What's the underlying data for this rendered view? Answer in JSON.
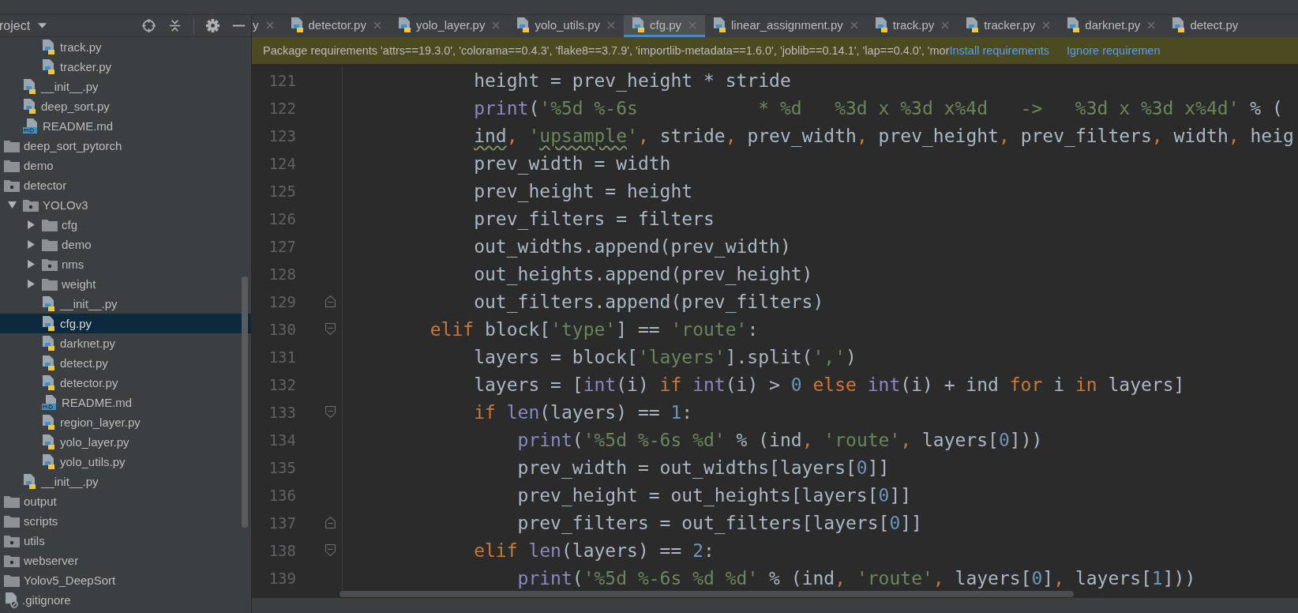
{
  "sidebar": {
    "header": {
      "title": "roject"
    },
    "tree": [
      {
        "children": [
          {
            "children": [
              {
                "label": "track.py",
                "kind": "python",
                "selected": false
              },
              {
                "label": "tracker.py",
                "kind": "python",
                "selected": false
              }
            ]
          },
          {
            "label": "__init__.py",
            "kind": "python",
            "selected": false
          },
          {
            "label": "deep_sort.py",
            "kind": "python",
            "selected": false
          },
          {
            "label": "README.md",
            "kind": "markdown",
            "selected": false
          }
        ]
      },
      {
        "label": "deep_sort_pytorch",
        "kind": "folder",
        "selected": false
      },
      {
        "label": "demo",
        "kind": "folder",
        "selected": false
      },
      {
        "label": "detector",
        "kind": "package",
        "selected": false,
        "children": [
          {
            "label": "YOLOv3",
            "kind": "package",
            "expanded": true,
            "selected": false,
            "children": [
              {
                "label": "cfg",
                "kind": "folder",
                "expanded": false,
                "selected": false
              },
              {
                "label": "demo",
                "kind": "folder",
                "expanded": false,
                "selected": false
              },
              {
                "label": "nms",
                "kind": "package",
                "expanded": false,
                "selected": false
              },
              {
                "label": "weight",
                "kind": "folder",
                "expanded": false,
                "selected": false
              },
              {
                "label": "__init__.py",
                "kind": "python",
                "selected": false
              },
              {
                "label": "cfg.py",
                "kind": "python",
                "selected": true
              },
              {
                "label": "darknet.py",
                "kind": "python",
                "selected": false
              },
              {
                "label": "detect.py",
                "kind": "python",
                "selected": false
              },
              {
                "label": "detector.py",
                "kind": "python",
                "selected": false
              },
              {
                "label": "README.md",
                "kind": "markdown",
                "selected": false
              },
              {
                "label": "region_layer.py",
                "kind": "python",
                "selected": false
              },
              {
                "label": "yolo_layer.py",
                "kind": "python",
                "selected": false
              },
              {
                "label": "yolo_utils.py",
                "kind": "python",
                "selected": false
              }
            ]
          },
          {
            "label": "__init__.py",
            "kind": "python",
            "selected": false
          }
        ]
      },
      {
        "label": "output",
        "kind": "folder",
        "selected": false
      },
      {
        "label": "scripts",
        "kind": "folder",
        "selected": false
      },
      {
        "label": "utils",
        "kind": "package",
        "selected": false
      },
      {
        "label": "webserver",
        "kind": "package",
        "selected": false
      },
      {
        "label": "Yolov5_DeepSort",
        "kind": "folder",
        "selected": false
      },
      {
        "label": ".gitignore",
        "kind": "gitignore",
        "selected": false
      }
    ]
  },
  "tabs": [
    {
      "label": "y",
      "icon": false,
      "closable": true,
      "selected": false
    },
    {
      "label": "detector.py",
      "icon": true,
      "closable": true,
      "selected": false
    },
    {
      "label": "yolo_layer.py",
      "icon": true,
      "closable": true,
      "selected": false
    },
    {
      "label": "yolo_utils.py",
      "icon": true,
      "closable": true,
      "selected": false
    },
    {
      "label": "cfg.py",
      "icon": true,
      "closable": true,
      "selected": true
    },
    {
      "label": "linear_assignment.py",
      "icon": true,
      "closable": true,
      "selected": false
    },
    {
      "label": "track.py",
      "icon": true,
      "closable": true,
      "selected": false
    },
    {
      "label": "tracker.py",
      "icon": true,
      "closable": true,
      "selected": false
    },
    {
      "label": "darknet.py",
      "icon": true,
      "closable": true,
      "selected": false
    },
    {
      "label": "detect.py",
      "icon": true,
      "closable": false,
      "selected": false
    }
  ],
  "banner": {
    "message": "Package requirements 'attrs==19.3.0', 'colorama==0.4.3', 'flake8==3.7.9', 'importlib-metadata==1.6.0', 'joblib==0.14.1', 'lap==0.4.0', 'mor",
    "actions": [
      "Install requirements",
      "Ignore requiremen"
    ]
  },
  "editor": {
    "lines": [
      {
        "number": "121",
        "kind": "plain",
        "tokens": [
          {
            "kind": "plain",
            "text": "            height = prev_height * stride",
            "typo": false
          }
        ]
      },
      {
        "number": "122",
        "kind": "plain",
        "tokens": [
          {
            "kind": "builtin",
            "text": "            print",
            "typo": false
          },
          {
            "kind": "plain",
            "text": "(",
            "typo": false
          },
          {
            "kind": "string",
            "text": "'%5d %-6s           * %d   %3d x %3d x%4d   ->   %3d x %3d x%4d'",
            "typo": false
          },
          {
            "kind": "plain",
            "text": " % (",
            "typo": false
          }
        ]
      },
      {
        "number": "123",
        "kind": "plain",
        "tokens": [
          {
            "kind": "plain",
            "text": "            ind",
            "typo": true
          },
          {
            "kind": "comma",
            "text": ", ",
            "typo": false
          },
          {
            "kind": "string",
            "text": "'",
            "typo": false
          },
          {
            "kind": "string",
            "text": "upsample",
            "typo": true
          },
          {
            "kind": "string",
            "text": "'",
            "typo": false
          },
          {
            "kind": "comma",
            "text": ", ",
            "typo": false
          },
          {
            "kind": "plain",
            "text": "stride",
            "typo": false
          },
          {
            "kind": "comma",
            "text": ", ",
            "typo": false
          },
          {
            "kind": "plain",
            "text": "prev_width",
            "typo": false
          },
          {
            "kind": "comma",
            "text": ", ",
            "typo": false
          },
          {
            "kind": "plain",
            "text": "prev_height",
            "typo": false
          },
          {
            "kind": "comma",
            "text": ", ",
            "typo": false
          },
          {
            "kind": "plain",
            "text": "prev_filters",
            "typo": false
          },
          {
            "kind": "comma",
            "text": ", ",
            "typo": false
          },
          {
            "kind": "plain",
            "text": "width",
            "typo": false
          },
          {
            "kind": "comma",
            "text": ", ",
            "typo": false
          },
          {
            "kind": "plain",
            "text": "heig",
            "typo": false
          }
        ]
      },
      {
        "number": "124",
        "kind": "plain",
        "tokens": [
          {
            "kind": "plain",
            "text": "            prev_width = width",
            "typo": false
          }
        ]
      },
      {
        "number": "125",
        "kind": "plain",
        "tokens": [
          {
            "kind": "plain",
            "text": "            prev_height = height",
            "typo": false
          }
        ]
      },
      {
        "number": "126",
        "kind": "plain",
        "tokens": [
          {
            "kind": "plain",
            "text": "            prev_filters = filters",
            "typo": false
          }
        ]
      },
      {
        "number": "127",
        "kind": "plain",
        "tokens": [
          {
            "kind": "plain",
            "text": "            out_widths.append(prev_width)",
            "typo": false
          }
        ]
      },
      {
        "number": "128",
        "kind": "plain",
        "tokens": [
          {
            "kind": "plain",
            "text": "            out_heights.append(prev_height)",
            "typo": false
          }
        ]
      },
      {
        "number": "129",
        "kind": "fold-end",
        "tokens": [
          {
            "kind": "plain",
            "text": "            out_filters.append(prev_filters)",
            "typo": false
          }
        ]
      },
      {
        "number": "130",
        "kind": "fold-start",
        "tokens": [
          {
            "kind": "keyword",
            "text": "        elif",
            "typo": false
          },
          {
            "kind": "plain",
            "text": " block[",
            "typo": false
          },
          {
            "kind": "string",
            "text": "'type'",
            "typo": false
          },
          {
            "kind": "plain",
            "text": "] == ",
            "typo": false
          },
          {
            "kind": "string",
            "text": "'route'",
            "typo": false
          },
          {
            "kind": "plain",
            "text": ":",
            "typo": false
          }
        ]
      },
      {
        "number": "131",
        "kind": "plain",
        "tokens": [
          {
            "kind": "plain",
            "text": "            layers = block[",
            "typo": false
          },
          {
            "kind": "string",
            "text": "'layers'",
            "typo": false
          },
          {
            "kind": "plain",
            "text": "].split(",
            "typo": false
          },
          {
            "kind": "string",
            "text": "','",
            "typo": false
          },
          {
            "kind": "plain",
            "text": ")",
            "typo": false
          }
        ]
      },
      {
        "number": "132",
        "kind": "plain",
        "tokens": [
          {
            "kind": "plain",
            "text": "            layers = [",
            "typo": false
          },
          {
            "kind": "builtin",
            "text": "int",
            "typo": false
          },
          {
            "kind": "plain",
            "text": "(i) ",
            "typo": false
          },
          {
            "kind": "keyword",
            "text": "if ",
            "typo": false
          },
          {
            "kind": "builtin",
            "text": "int",
            "typo": false
          },
          {
            "kind": "plain",
            "text": "(i) > ",
            "typo": false
          },
          {
            "kind": "number",
            "text": "0 ",
            "typo": false
          },
          {
            "kind": "keyword",
            "text": "else ",
            "typo": false
          },
          {
            "kind": "builtin",
            "text": "int",
            "typo": false
          },
          {
            "kind": "plain",
            "text": "(i) + ind ",
            "typo": false
          },
          {
            "kind": "keyword",
            "text": "for",
            "typo": false
          },
          {
            "kind": "plain",
            "text": " i ",
            "typo": false
          },
          {
            "kind": "keyword",
            "text": "in",
            "typo": false
          },
          {
            "kind": "plain",
            "text": " layers]",
            "typo": false
          }
        ]
      },
      {
        "number": "133",
        "kind": "fold-start",
        "tokens": [
          {
            "kind": "keyword",
            "text": "            if ",
            "typo": false
          },
          {
            "kind": "builtin",
            "text": "len",
            "typo": false
          },
          {
            "kind": "plain",
            "text": "(layers) == ",
            "typo": false
          },
          {
            "kind": "number",
            "text": "1",
            "typo": false
          },
          {
            "kind": "plain",
            "text": ":",
            "typo": false
          }
        ]
      },
      {
        "number": "134",
        "kind": "plain",
        "tokens": [
          {
            "kind": "builtin",
            "text": "                print",
            "typo": false
          },
          {
            "kind": "plain",
            "text": "(",
            "typo": false
          },
          {
            "kind": "string",
            "text": "'%5d %-6s %d'",
            "typo": false
          },
          {
            "kind": "plain",
            "text": " % (ind",
            "typo": false
          },
          {
            "kind": "comma",
            "text": ", ",
            "typo": false
          },
          {
            "kind": "string",
            "text": "'route'",
            "typo": false
          },
          {
            "kind": "comma",
            "text": ", ",
            "typo": false
          },
          {
            "kind": "plain",
            "text": "layers[",
            "typo": false
          },
          {
            "kind": "number",
            "text": "0",
            "typo": false
          },
          {
            "kind": "plain",
            "text": "]))",
            "typo": false
          }
        ]
      },
      {
        "number": "135",
        "kind": "plain",
        "tokens": [
          {
            "kind": "plain",
            "text": "                prev_width = out_widths[layers[",
            "typo": false
          },
          {
            "kind": "number",
            "text": "0",
            "typo": false
          },
          {
            "kind": "plain",
            "text": "]]",
            "typo": false
          }
        ]
      },
      {
        "number": "136",
        "kind": "plain",
        "tokens": [
          {
            "kind": "plain",
            "text": "                prev_height = out_heights[layers[",
            "typo": false
          },
          {
            "kind": "number",
            "text": "0",
            "typo": false
          },
          {
            "kind": "plain",
            "text": "]]",
            "typo": false
          }
        ]
      },
      {
        "number": "137",
        "kind": "fold-end",
        "tokens": [
          {
            "kind": "plain",
            "text": "                prev_filters = out_filters[layers[",
            "typo": false
          },
          {
            "kind": "number",
            "text": "0",
            "typo": false
          },
          {
            "kind": "plain",
            "text": "]]",
            "typo": false
          }
        ]
      },
      {
        "number": "138",
        "kind": "fold-start",
        "tokens": [
          {
            "kind": "keyword",
            "text": "            elif ",
            "typo": false
          },
          {
            "kind": "builtin",
            "text": "len",
            "typo": false
          },
          {
            "kind": "plain",
            "text": "(layers) == ",
            "typo": false
          },
          {
            "kind": "number",
            "text": "2",
            "typo": false
          },
          {
            "kind": "plain",
            "text": ":",
            "typo": false
          }
        ]
      },
      {
        "number": "139",
        "kind": "plain",
        "tokens": [
          {
            "kind": "builtin",
            "text": "                print",
            "typo": false
          },
          {
            "kind": "plain",
            "text": "(",
            "typo": false
          },
          {
            "kind": "string",
            "text": "'%5d %-6s %d %d'",
            "typo": false
          },
          {
            "kind": "plain",
            "text": " % (ind",
            "typo": false
          },
          {
            "kind": "comma",
            "text": ", ",
            "typo": false
          },
          {
            "kind": "string",
            "text": "'route'",
            "typo": false
          },
          {
            "kind": "comma",
            "text": ", ",
            "typo": false
          },
          {
            "kind": "plain",
            "text": "layers[",
            "typo": false
          },
          {
            "kind": "number",
            "text": "0",
            "typo": false
          },
          {
            "kind": "plain",
            "text": "]",
            "typo": false
          },
          {
            "kind": "comma",
            "text": ", ",
            "typo": false
          },
          {
            "kind": "plain",
            "text": "layers[",
            "typo": false
          },
          {
            "kind": "number",
            "text": "1",
            "typo": false
          },
          {
            "kind": "plain",
            "text": "]))",
            "typo": false
          }
        ]
      }
    ]
  }
}
